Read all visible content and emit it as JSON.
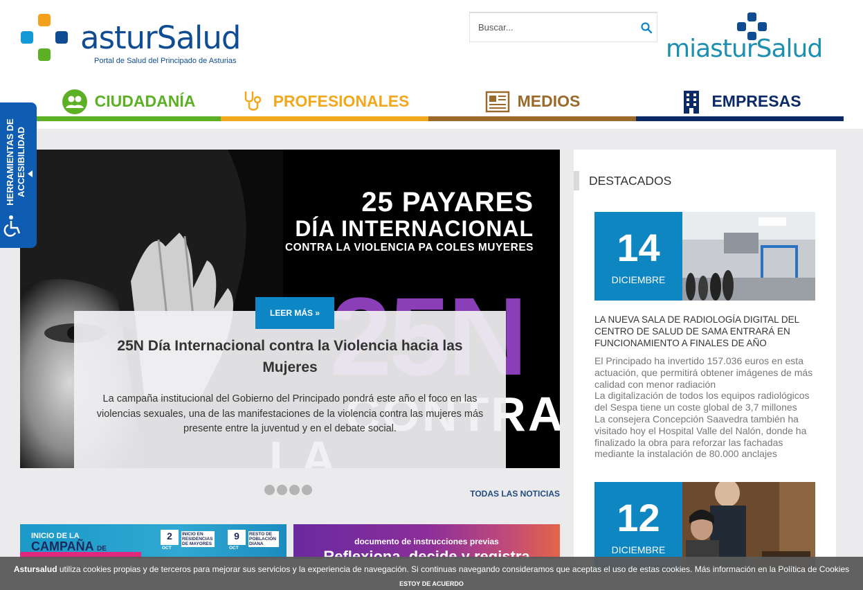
{
  "header": {
    "logo_text": "asturSalud",
    "logo_subtitle": "Portal de Salud del Principado de Asturias",
    "search_placeholder": "Buscar...",
    "mia_logo_text": "miasturSalud"
  },
  "nav": [
    {
      "label": "Ciudadanía",
      "icon": "users-icon",
      "color": "#5bb025"
    },
    {
      "label": "Profesionales",
      "icon": "stethoscope-icon",
      "color": "#f2a81d"
    },
    {
      "label": "Medios",
      "icon": "newspaper-icon",
      "color": "#9a6a2b"
    },
    {
      "label": "Empresas",
      "icon": "building-icon",
      "color": "#0c2a67"
    }
  ],
  "accessibility": {
    "label": "Herramientas de accesibilidad"
  },
  "hero": {
    "line1": "25 PAYARES",
    "line2": "DÍA INTERNACIONAL",
    "line3": "CONTRA LA VIOLENCIA PA COLES MUYERES",
    "big": "25N",
    "contra1": "CONTRA",
    "contra2": "LA VIOLENCIA",
    "read_more": "LEER MÁS »",
    "title": "25N Día Internacional contra la Violencia hacia las Mujeres",
    "text": "La campaña institucional del Gobierno del Principado pondrá este año el foco en las violencias sexuales, una de las manifestaciones de la violencia contra las mujeres más presente entre la juventud y en el debate social.",
    "slide_count": 4,
    "all_news": "Todas las noticias"
  },
  "banners": {
    "b1_line1": "INICIO DE LA",
    "b1_line2": "CAMPAÑA",
    "b1_line2b": "DE",
    "b1_date1_day": "2",
    "b1_date1_month": "OCT",
    "b1_date1_label": "INICIO EN RESIDENCIAS DE MAYORES",
    "b1_date2_day": "9",
    "b1_date2_month": "OCT",
    "b1_date2_label": "RESTO DE POBLACIÓN DIANA",
    "b2_line1": "documento de instrucciones previas",
    "b2_line2": "Reflexiona, decide y registra"
  },
  "sidebar": {
    "heading": "Destacados",
    "items": [
      {
        "day": "14",
        "month": "Diciembre",
        "title": "La nueva sala de radiología digital del Centro de Salud de Sama entrará en funcionamiento a finales de año",
        "bullets": [
          "El Principado ha invertido 157.036 euros en esta actuación, que permitirá obtener imágenes de más calidad con menor radiación",
          "La digitalización de todos los equipos radiológicos del Sespa tiene un coste global de 3,7 millones",
          "La consejera Concepción Saavedra también ha visitado hoy el Hospital Valle del Nalón, donde ha finalizado la obra para reforzar las fachadas mediante la instalación de 80.000 anclajes"
        ]
      },
      {
        "day": "12",
        "month": "Diciembre"
      }
    ]
  },
  "cookie": {
    "brand": "Astursalud",
    "text": " utiliza cookies propias y de terceros para mejorar sus servicios y la experiencia de navegación. Si continuas navegando consideramos que aceptas el uso de estas cookies. Más información en la Política de Cookies",
    "accept": "Estoy de acuerdo"
  }
}
